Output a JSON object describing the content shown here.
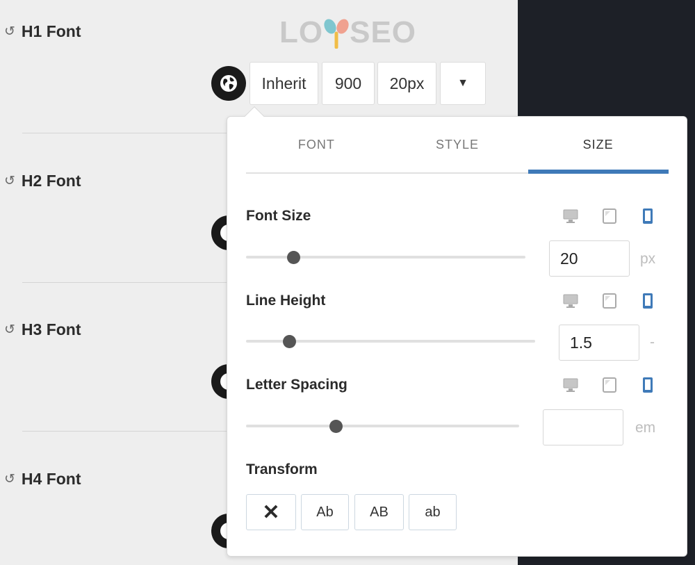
{
  "sections": {
    "h1": {
      "label": "H1 Font",
      "reset_icon": "↺"
    },
    "h2": {
      "label": "H2 Font",
      "reset_icon": "↺"
    },
    "h3": {
      "label": "H3 Font",
      "reset_icon": "↺"
    },
    "h4": {
      "label": "H4 Font",
      "reset_icon": "↺"
    }
  },
  "logo": {
    "left_text": "LO",
    "right_text": "SEO"
  },
  "h1_controls": {
    "family": "Inherit",
    "weight": "900",
    "size": "20px",
    "dropdown_icon": "▼"
  },
  "popover": {
    "tabs": [
      "FONT",
      "STYLE",
      "SIZE"
    ],
    "active_tab": "SIZE",
    "font_size": {
      "label": "Font Size",
      "value": "20",
      "unit": "px",
      "slider_fraction": 0.17
    },
    "line_height": {
      "label": "Line Height",
      "value": "1.5",
      "unit": "-",
      "slider_fraction": 0.15
    },
    "letter_spacing": {
      "label": "Letter Spacing",
      "value": "",
      "unit": "em",
      "slider_fraction": 0.33
    },
    "transform": {
      "label": "Transform",
      "options": [
        "✕",
        "Ab",
        "AB",
        "ab"
      ]
    },
    "device_icons": [
      "desktop-icon",
      "tablet-icon",
      "mobile-icon"
    ],
    "active_device": "mobile"
  },
  "colors": {
    "accent": "#3f7ab8",
    "device_active": "#3f7ab8",
    "device_inactive": "#aaaaaa",
    "panel_bg": "#eeeeee",
    "dark_bg": "#1d2027"
  }
}
